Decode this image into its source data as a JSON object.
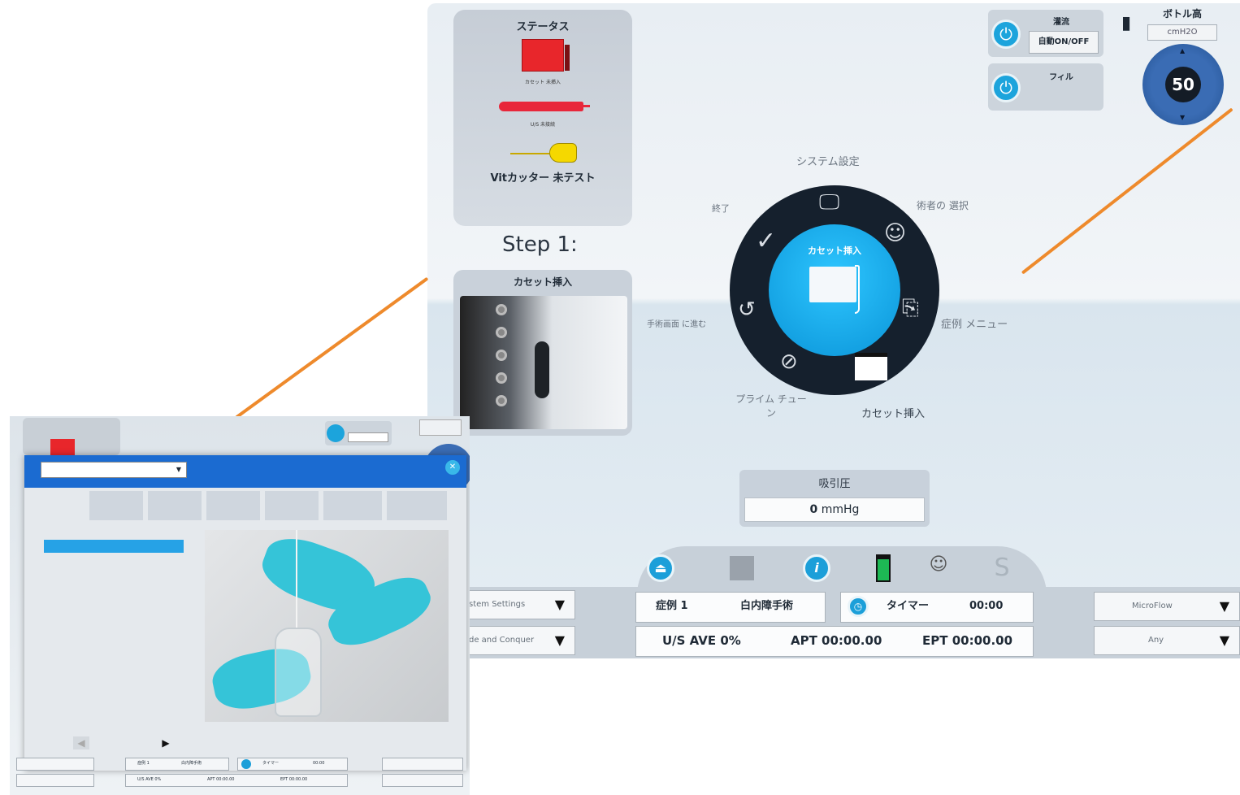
{
  "main": {
    "status": {
      "title": "ステータス",
      "cassette_caption": "カセット 未挿入",
      "us_caption": "U/S 未接続",
      "vit_label": "Vitカッター 未テスト"
    },
    "step": {
      "title": "Step 1:",
      "panel_label": "カセット挿入"
    },
    "radial_menu": {
      "center_label": "カセット挿入",
      "items": {
        "system_settings": "システム設定",
        "surgeon_select": "術者の 選択",
        "case_menu": "症例 メニュー",
        "cassette_insert": "カセット挿入",
        "prime_tune": "プライム チューン",
        "go_to_surgery": "手術画面 に進む",
        "finish": "終了"
      }
    },
    "irrigation": {
      "label": "灌流",
      "auto_label": "自動ON/OFF",
      "fill_label": "フィル"
    },
    "bottle": {
      "label": "ボトル高",
      "unit": "cmH2O",
      "value": "50"
    },
    "suction": {
      "label": "吸引圧",
      "value": "0",
      "unit": "mmHg"
    },
    "bottom": {
      "left_dropdown_1": "stem Settings",
      "left_dropdown_2": "de and Conquer",
      "case_label": "症例 1",
      "procedure": "白内障手術",
      "timer_label": "タイマー",
      "timer_value": "00:00",
      "us_ave": "U/S AVE 0%",
      "apt": "APT 00:00.00",
      "ept": "EPT 00:00.00",
      "right_dropdown_1": "MicroFlow",
      "right_dropdown_2": "Any"
    },
    "colors": {
      "accent_blue": "#1c9fd9",
      "wheel_dark": "#15202d",
      "connector_orange": "#ee8a2c",
      "status_red": "#e8262b"
    }
  },
  "overlay": {
    "bottom": {
      "case_label": "症例 1",
      "procedure": "白内障手術",
      "timer_label": "タイマー",
      "timer_value": "00:00",
      "us_ave": "U/S AVE 0%",
      "apt": "APT 00:00.00",
      "ept": "EPT 00:00.00"
    }
  }
}
